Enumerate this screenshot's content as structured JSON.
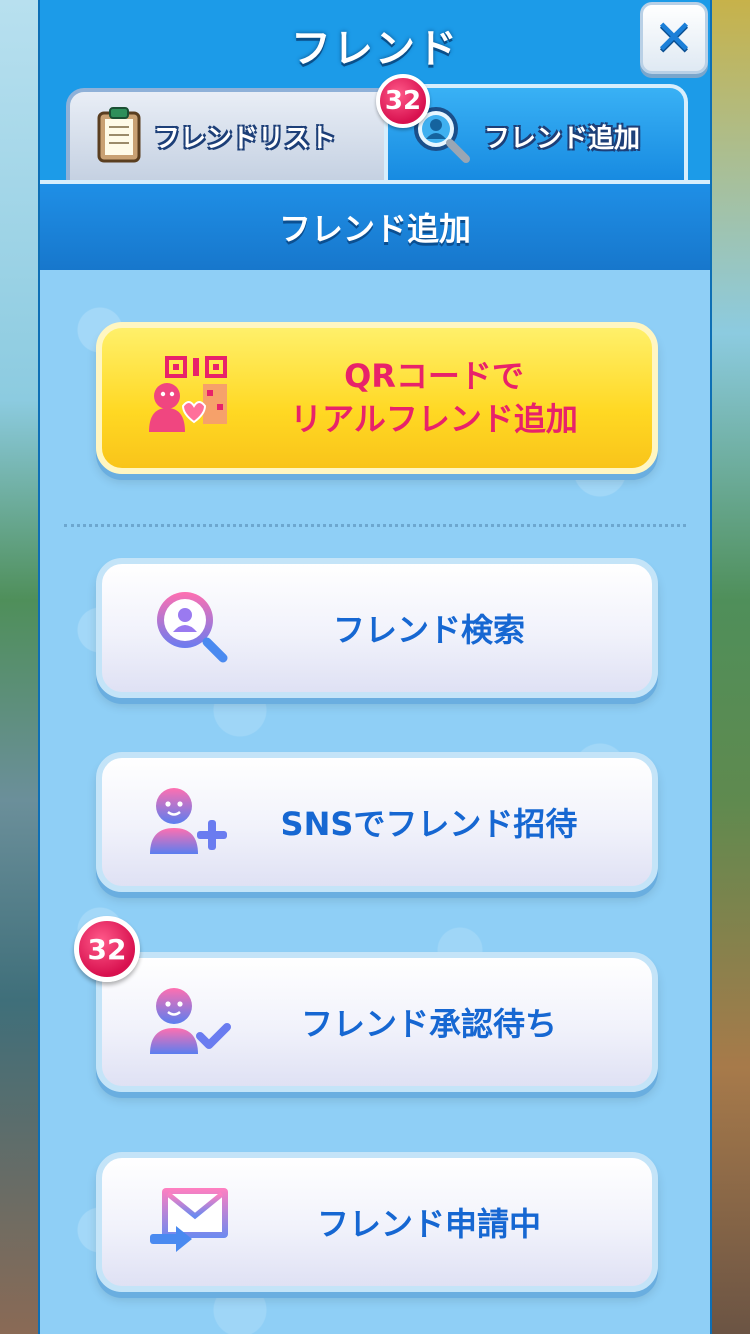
{
  "window": {
    "title": "フレンド"
  },
  "tabs": [
    {
      "label": "フレンドリスト"
    },
    {
      "label": "フレンド追加",
      "badge": "32"
    }
  ],
  "section": {
    "title": "フレンド追加"
  },
  "buttons": {
    "qr": {
      "line1": "QRコードで",
      "line2": "リアルフレンド追加"
    },
    "search": {
      "label": "フレンド検索"
    },
    "invite": {
      "label": "SNSでフレンド招待"
    },
    "pending": {
      "label": "フレンド承認待ち",
      "badge": "32"
    },
    "requested": {
      "label": "フレンド申請中"
    }
  },
  "close": {
    "symbol": "✕"
  },
  "colors": {
    "accent_blue": "#1c9be8",
    "label_blue": "#1667d2",
    "qr_yellow": "#ffd823",
    "qr_pink": "#e8226a",
    "badge_pink": "#d8114f"
  },
  "icons": [
    "clipboard-icon",
    "search-person-icon",
    "qr-code-icon",
    "add-person-icon",
    "check-person-icon",
    "mail-send-icon",
    "close-icon"
  ]
}
